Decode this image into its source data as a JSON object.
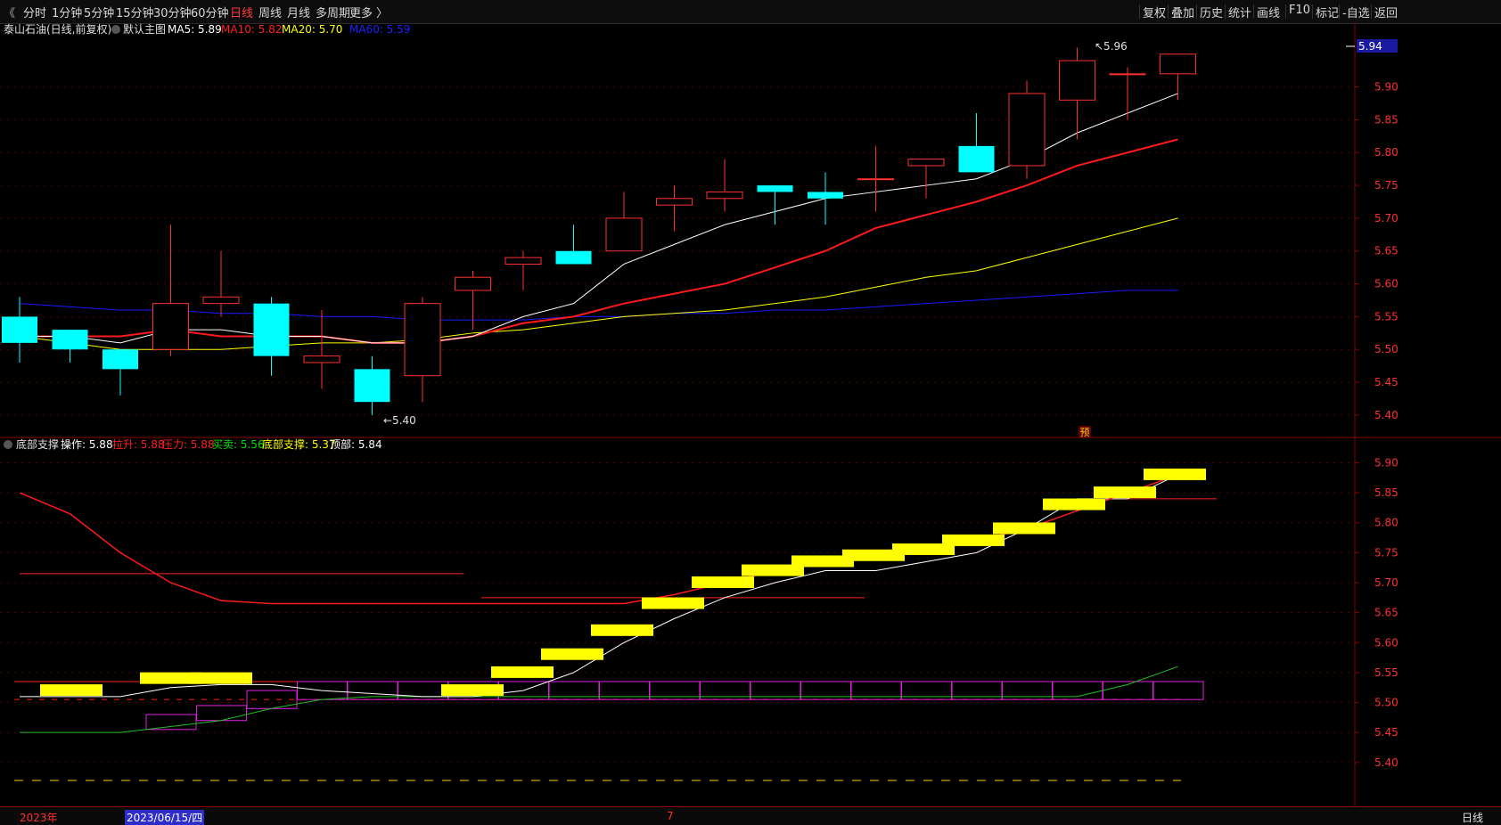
{
  "toolbar": {
    "left_icon": "《",
    "periods": [
      "分时",
      "1分钟",
      "5分钟",
      "15分钟",
      "30分钟",
      "60分钟",
      "日线",
      "周线",
      "月线",
      "多周期",
      "更多 〉"
    ],
    "active_period": "日线",
    "right_items": [
      "复权",
      "叠加",
      "历史",
      "统计",
      "画线",
      "F10",
      "标记",
      "-自选",
      "返回"
    ]
  },
  "main_panel": {
    "stock_title": "泰山石油(日线,前复权)",
    "template_label": "默认主图",
    "ma_labels": [
      {
        "text": "MA5: 5.89",
        "color": "#ffffff"
      },
      {
        "text": "MA10: 5.82",
        "color": "#ff2020"
      },
      {
        "text": "MA20: 5.70",
        "color": "#ffff00"
      },
      {
        "text": "MA60: 5.59",
        "color": "#2020ff"
      }
    ],
    "current_price_tag": "5.94",
    "high_annotation": "5.96",
    "low_annotation": "5.40",
    "forecast_mark": "预",
    "y_ticks": [
      "5.90",
      "5.85",
      "5.80",
      "5.75",
      "5.70",
      "5.65",
      "5.60",
      "5.55",
      "5.50",
      "5.45",
      "5.40"
    ]
  },
  "sub_panel": {
    "indicator_name": "底部支撑",
    "labels": [
      {
        "text": "操作: 5.88",
        "color": "#ffffff"
      },
      {
        "text": "拉升: 5.88",
        "color": "#ff2020"
      },
      {
        "text": "压力: 5.88",
        "color": "#ff2020"
      },
      {
        "text": "买卖: 5.56",
        "color": "#00e000"
      },
      {
        "text": "底部支撑: 5.37",
        "color": "#ffff00"
      },
      {
        "text": "顶部: 5.84",
        "color": "#ffffff"
      }
    ],
    "y_ticks": [
      "5.90",
      "5.85",
      "5.80",
      "5.75",
      "5.70",
      "5.65",
      "5.60",
      "5.55",
      "5.50",
      "5.45",
      "5.40"
    ]
  },
  "bottom_bar": {
    "year_label": "2023年",
    "cursor_date": "2023/06/15/四",
    "month_mark": "7",
    "period_label": "日线"
  },
  "colors": {
    "up": "#ff3030",
    "down": "#00ffff",
    "ma5": "#ffffff",
    "ma10": "#ff1a1a",
    "ma20": "#ffff00",
    "ma60": "#1a1aff",
    "grid": "#5a0000",
    "axis": "#8b0000"
  },
  "chart_data": {
    "type": "candlestick",
    "y_range": [
      5.37,
      5.97
    ],
    "candles": [
      {
        "o": 5.55,
        "h": 5.58,
        "l": 5.48,
        "c": 5.51
      },
      {
        "o": 5.53,
        "h": 5.53,
        "l": 5.48,
        "c": 5.5
      },
      {
        "o": 5.5,
        "h": 5.5,
        "l": 5.43,
        "c": 5.47
      },
      {
        "o": 5.5,
        "h": 5.69,
        "l": 5.49,
        "c": 5.57
      },
      {
        "o": 5.57,
        "h": 5.65,
        "l": 5.55,
        "c": 5.58
      },
      {
        "o": 5.57,
        "h": 5.58,
        "l": 5.46,
        "c": 5.49
      },
      {
        "o": 5.48,
        "h": 5.56,
        "l": 5.44,
        "c": 5.49
      },
      {
        "o": 5.47,
        "h": 5.49,
        "l": 5.4,
        "c": 5.42
      },
      {
        "o": 5.46,
        "h": 5.58,
        "l": 5.42,
        "c": 5.57
      },
      {
        "o": 5.59,
        "h": 5.62,
        "l": 5.53,
        "c": 5.61
      },
      {
        "o": 5.63,
        "h": 5.65,
        "l": 5.59,
        "c": 5.64
      },
      {
        "o": 5.65,
        "h": 5.69,
        "l": 5.63,
        "c": 5.63
      },
      {
        "o": 5.65,
        "h": 5.74,
        "l": 5.65,
        "c": 5.7
      },
      {
        "o": 5.72,
        "h": 5.75,
        "l": 5.68,
        "c": 5.73
      },
      {
        "o": 5.73,
        "h": 5.79,
        "l": 5.71,
        "c": 5.74
      },
      {
        "o": 5.75,
        "h": 5.75,
        "l": 5.69,
        "c": 5.74
      },
      {
        "o": 5.74,
        "h": 5.77,
        "l": 5.69,
        "c": 5.73
      },
      {
        "o": 5.76,
        "h": 5.81,
        "l": 5.71,
        "c": 5.76
      },
      {
        "o": 5.78,
        "h": 5.79,
        "l": 5.73,
        "c": 5.79
      },
      {
        "o": 5.81,
        "h": 5.86,
        "l": 5.77,
        "c": 5.77
      },
      {
        "o": 5.78,
        "h": 5.91,
        "l": 5.76,
        "c": 5.89
      },
      {
        "o": 5.88,
        "h": 5.96,
        "l": 5.82,
        "c": 5.94
      },
      {
        "o": 5.92,
        "h": 5.93,
        "l": 5.85,
        "c": 5.92
      },
      {
        "o": 5.92,
        "h": 5.95,
        "l": 5.88,
        "c": 5.95
      }
    ],
    "series": [
      {
        "name": "MA5",
        "values": [
          5.52,
          5.52,
          5.51,
          5.53,
          5.53,
          5.52,
          5.52,
          5.51,
          5.51,
          5.52,
          5.55,
          5.57,
          5.63,
          5.66,
          5.69,
          5.71,
          5.73,
          5.74,
          5.75,
          5.76,
          5.79,
          5.83,
          5.86,
          5.89
        ]
      },
      {
        "name": "MA10",
        "values": [
          5.52,
          5.52,
          5.52,
          5.53,
          5.52,
          5.52,
          5.52,
          5.51,
          5.51,
          5.52,
          5.54,
          5.55,
          5.57,
          5.585,
          5.6,
          5.625,
          5.65,
          5.685,
          5.705,
          5.725,
          5.75,
          5.78,
          5.8,
          5.82
        ]
      },
      {
        "name": "MA20",
        "values": [
          5.52,
          5.51,
          5.5,
          5.5,
          5.5,
          5.505,
          5.51,
          5.51,
          5.515,
          5.525,
          5.53,
          5.54,
          5.55,
          5.555,
          5.56,
          5.57,
          5.58,
          5.595,
          5.61,
          5.62,
          5.64,
          5.66,
          5.68,
          5.7
        ]
      },
      {
        "name": "MA60",
        "values": [
          5.57,
          5.565,
          5.56,
          5.56,
          5.555,
          5.555,
          5.55,
          5.55,
          5.545,
          5.545,
          5.545,
          5.55,
          5.55,
          5.555,
          5.555,
          5.56,
          5.56,
          5.565,
          5.57,
          5.575,
          5.58,
          5.585,
          5.59,
          5.59
        ]
      }
    ],
    "sub_chart": {
      "y_range": [
        5.37,
        5.92
      ],
      "yellow_bars": [
        [
          5.52,
          5.52
        ],
        [
          5.54,
          5.54
        ],
        [
          5.54,
          5.54
        ],
        [
          5.52,
          5.52
        ],
        [
          5.55,
          5.55
        ],
        [
          5.58,
          5.58
        ],
        [
          5.62,
          5.62
        ],
        [
          5.665,
          5.665
        ],
        [
          5.7,
          5.7
        ],
        [
          5.72,
          5.72
        ],
        [
          5.735,
          5.735
        ],
        [
          5.745,
          5.745
        ],
        [
          5.755,
          5.755
        ],
        [
          5.77,
          5.77
        ],
        [
          5.79,
          5.79
        ],
        [
          5.83,
          5.83
        ],
        [
          5.85,
          5.85
        ],
        [
          5.88,
          5.88
        ]
      ],
      "red_line": [
        5.85,
        5.815,
        5.75,
        5.7,
        5.67,
        5.665,
        5.665,
        5.665,
        5.665,
        5.665,
        5.665,
        5.665,
        5.665,
        5.68,
        5.7,
        5.72,
        5.74,
        5.75,
        5.76,
        5.77,
        5.79,
        5.82,
        5.85,
        5.88
      ],
      "white_line": [
        5.51,
        5.51,
        5.51,
        5.525,
        5.53,
        5.53,
        5.52,
        5.515,
        5.51,
        5.51,
        5.52,
        5.55,
        5.6,
        5.64,
        5.675,
        5.7,
        5.72,
        5.72,
        5.735,
        5.75,
        5.79,
        5.84,
        5.84,
        5.88
      ],
      "green_line": [
        5.45,
        5.45,
        5.45,
        5.46,
        5.47,
        5.49,
        5.505,
        5.51,
        5.51,
        5.51,
        5.51,
        5.51,
        5.51,
        5.51,
        5.51,
        5.51,
        5.51,
        5.51,
        5.51,
        5.51,
        5.51,
        5.51,
        5.53,
        5.56
      ],
      "magenta_boxes": [
        [
          5.455,
          5.48
        ],
        [
          5.47,
          5.495
        ],
        [
          5.49,
          5.52
        ],
        [
          5.505,
          5.535
        ],
        [
          5.505,
          5.535
        ],
        [
          5.505,
          5.535
        ],
        [
          5.505,
          5.535
        ],
        [
          5.505,
          5.535
        ],
        [
          5.505,
          5.535
        ],
        [
          5.505,
          5.535
        ],
        [
          5.505,
          5.535
        ],
        [
          5.505,
          5.535
        ],
        [
          5.505,
          5.535
        ],
        [
          5.505,
          5.535
        ],
        [
          5.505,
          5.535
        ],
        [
          5.505,
          5.535
        ],
        [
          5.505,
          5.535
        ],
        [
          5.505,
          5.535
        ],
        [
          5.505,
          5.535
        ],
        [
          5.505,
          5.535
        ],
        [
          5.505,
          5.535
        ],
        [
          5.535,
          5.565
        ],
        [
          5.565,
          5.59
        ]
      ],
      "bottom_dashed": 5.37
    }
  }
}
